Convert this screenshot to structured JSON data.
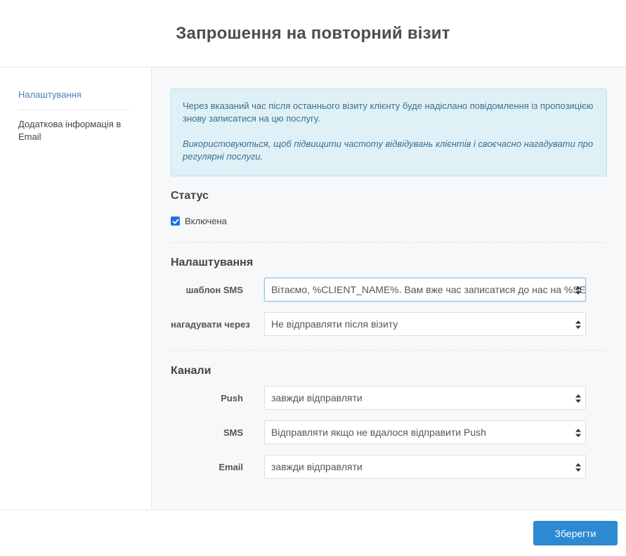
{
  "header": {
    "title": "Запрошення на повторний візит"
  },
  "sidebar": {
    "items": [
      {
        "label": "Налаштування"
      },
      {
        "label": "Додаткова інформація в Email"
      }
    ]
  },
  "info": {
    "line1": "Через вказаний час після останнього візиту клієнту буде надіслано повідомлення із пропозицією знову записатися на цю послугу.",
    "line2": "Використовуються, щоб підвищити частоту відвідувань клієнтів і своєчасно нагадувати про регулярні послуги."
  },
  "status": {
    "title": "Статус",
    "enabled_label": "Включена",
    "enabled": true
  },
  "settings": {
    "title": "Налаштування",
    "sms_template_label": "шаблон SMS",
    "sms_template_value": "Вітаємо, %CLIENT_NAME%. Вам вже час записатися до нас на %SERVICE%",
    "remind_label": "нагадувати через",
    "remind_value": "Не відправляти після візиту"
  },
  "channels": {
    "title": "Канали",
    "push_label": "Push",
    "push_value": "завжди відправляти",
    "sms_label": "SMS",
    "sms_value": "Відправляти якщо не вдалося відправити Push",
    "email_label": "Email",
    "email_value": "завжди відправляти"
  },
  "footer": {
    "save_label": "Зберегти"
  },
  "colors": {
    "accent": "#2d8ad2",
    "info_bg": "#dff0f7",
    "info_text": "#3a6f8f",
    "sidebar_active": "#4f7fb5"
  }
}
